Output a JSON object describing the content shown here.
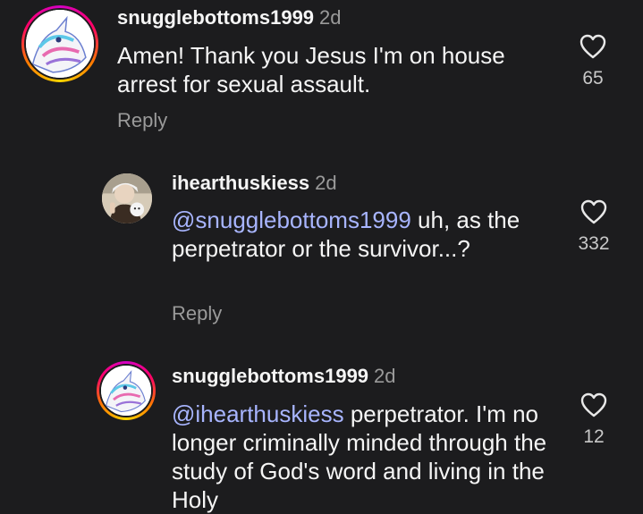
{
  "comments": [
    {
      "username": "snugglebottoms1999",
      "time": "2d",
      "mention": "",
      "text": "Amen! Thank you Jesus I'm on house arrest for sexual assault.",
      "reply_label": "Reply",
      "likes": "65",
      "avatar": "unicorn-avatar",
      "has_story_ring": true
    },
    {
      "username": "ihearthuskiess",
      "time": "2d",
      "mention": "@snugglebottoms1999",
      "text": " uh, as the perpetrator or the survivor...?",
      "reply_label": "Reply",
      "likes": "332",
      "avatar": "photo-avatar",
      "has_story_ring": false
    },
    {
      "username": "snugglebottoms1999",
      "time": "2d",
      "mention": "@ihearthuskiess",
      "text": " perpetrator. I'm no longer criminally minded through the study of God's word and living in the Holy",
      "reply_label": "",
      "likes": "12",
      "avatar": "unicorn-avatar",
      "has_story_ring": true
    }
  ],
  "colors": {
    "background": "#1c1c1e",
    "mention": "#a8b5ff",
    "muted": "#9a9a9a"
  },
  "icons": {
    "like": "heart-outline-icon"
  }
}
